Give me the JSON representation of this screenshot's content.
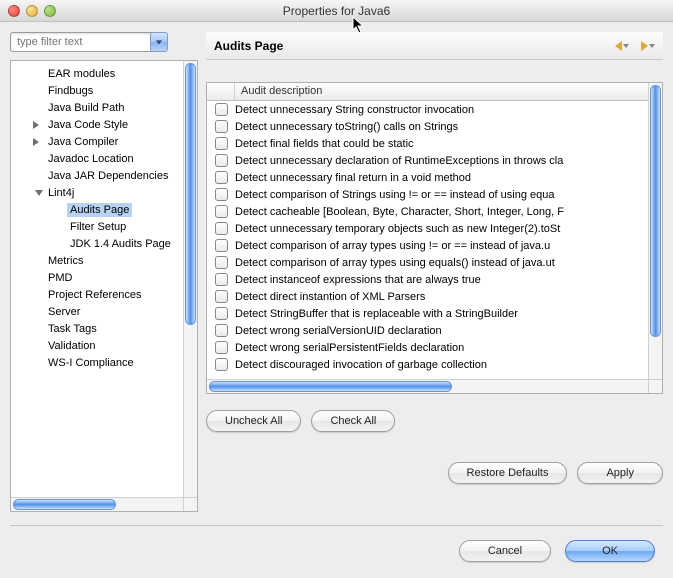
{
  "window": {
    "title": "Properties for Java6"
  },
  "filter": {
    "placeholder": "type filter text"
  },
  "tree": {
    "items": [
      {
        "label": "EAR modules",
        "indent": 1,
        "disclosure": "",
        "selected": false
      },
      {
        "label": "Findbugs",
        "indent": 1,
        "disclosure": "",
        "selected": false
      },
      {
        "label": "Java Build Path",
        "indent": 1,
        "disclosure": "",
        "selected": false
      },
      {
        "label": "Java Code Style",
        "indent": 1,
        "disclosure": "right",
        "selected": false
      },
      {
        "label": "Java Compiler",
        "indent": 1,
        "disclosure": "right",
        "selected": false
      },
      {
        "label": "Javadoc Location",
        "indent": 1,
        "disclosure": "",
        "selected": false
      },
      {
        "label": "Java JAR Dependencies",
        "indent": 1,
        "disclosure": "",
        "selected": false
      },
      {
        "label": "Lint4j",
        "indent": 1,
        "disclosure": "down",
        "selected": false
      },
      {
        "label": "Audits Page",
        "indent": 2,
        "disclosure": "",
        "selected": true
      },
      {
        "label": "Filter Setup",
        "indent": 2,
        "disclosure": "",
        "selected": false
      },
      {
        "label": "JDK 1.4 Audits Page",
        "indent": 2,
        "disclosure": "",
        "selected": false
      },
      {
        "label": "Metrics",
        "indent": 1,
        "disclosure": "",
        "selected": false
      },
      {
        "label": "PMD",
        "indent": 1,
        "disclosure": "",
        "selected": false
      },
      {
        "label": "Project References",
        "indent": 1,
        "disclosure": "",
        "selected": false
      },
      {
        "label": "Server",
        "indent": 1,
        "disclosure": "",
        "selected": false
      },
      {
        "label": "Task Tags",
        "indent": 1,
        "disclosure": "",
        "selected": false
      },
      {
        "label": "Validation",
        "indent": 1,
        "disclosure": "",
        "selected": false
      },
      {
        "label": "WS-I Compliance",
        "indent": 1,
        "disclosure": "",
        "selected": false
      }
    ]
  },
  "page": {
    "title": "Audits Page"
  },
  "table": {
    "header_description": "Audit description",
    "rows": [
      "Detect unnecessary String constructor invocation",
      "Detect unnecessary toString() calls on Strings",
      "Detect final fields that could be static",
      "Detect unnecessary declaration of RuntimeExceptions in throws cla",
      "Detect unnecessary final return in a void method",
      "Detect comparison of Strings using != or == instead of using equa",
      "Detect cacheable [Boolean, Byte, Character, Short, Integer, Long, F",
      "Detect unnecessary temporary objects such as new Integer(2).toSt",
      "Detect comparison of array types using != or == instead of java.u",
      "Detect comparison of array types using equals() instead of java.ut",
      "Detect instanceof expressions that are always true",
      "Detect direct instantion of XML Parsers",
      "Detect StringBuffer that is replaceable with a StringBuilder",
      "Detect wrong serialVersionUID declaration",
      "Detect wrong serialPersistentFields declaration",
      "Detect discouraged invocation of garbage collection"
    ]
  },
  "buttons": {
    "uncheck_all": "Uncheck All",
    "check_all": "Check All",
    "restore_defaults": "Restore Defaults",
    "apply": "Apply",
    "cancel": "Cancel",
    "ok": "OK"
  }
}
